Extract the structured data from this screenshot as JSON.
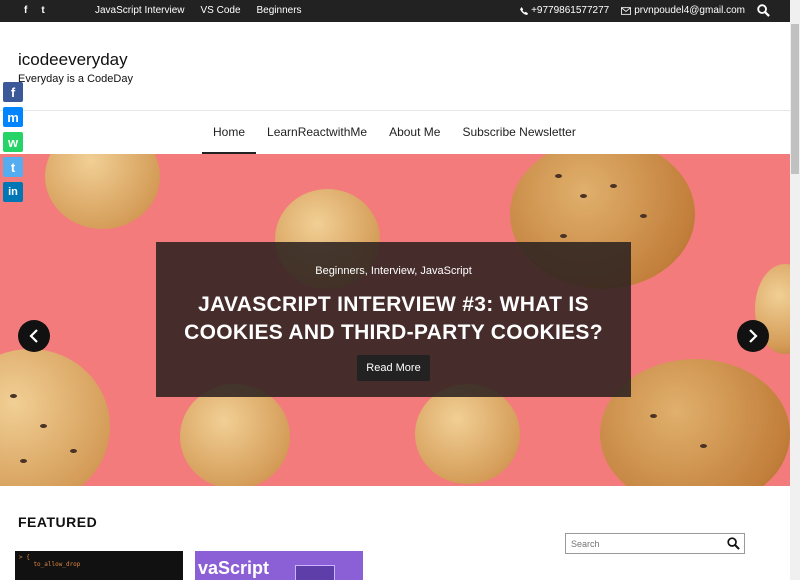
{
  "topbar": {
    "social": [
      "f",
      "t"
    ],
    "links": [
      "JavaScript Interview",
      "VS Code",
      "Beginners"
    ],
    "phone": "+9779861577277",
    "email": "prvnpoudel4@gmail.com"
  },
  "site": {
    "title": "icodeeveryday",
    "tagline": "Everyday is a CodeDay"
  },
  "share": [
    {
      "icon": "facebook-icon",
      "glyph": "f",
      "color": "#3b5998"
    },
    {
      "icon": "messenger-icon",
      "glyph": "m",
      "color": "#0084ff"
    },
    {
      "icon": "whatsapp-icon",
      "glyph": "w",
      "color": "#25d366"
    },
    {
      "icon": "twitter-icon",
      "glyph": "t",
      "color": "#55acee"
    },
    {
      "icon": "linkedin-icon",
      "glyph": "in",
      "color": "#0077b5"
    }
  ],
  "nav": [
    "Home",
    "LearnReactwithMe",
    "About Me",
    "Subscribe Newsletter"
  ],
  "hero": {
    "categories": "Beginners, Interview, JavaScript",
    "headline_line1": "JavaScript Interview #3: What is",
    "headline_line2": "Cookies and Third-Party Cookies?",
    "button": "Read More",
    "background": "#f47b7c"
  },
  "featured": {
    "title": "FEATURED",
    "thumb2_text": "vaScript"
  },
  "search": {
    "placeholder": "Search"
  }
}
